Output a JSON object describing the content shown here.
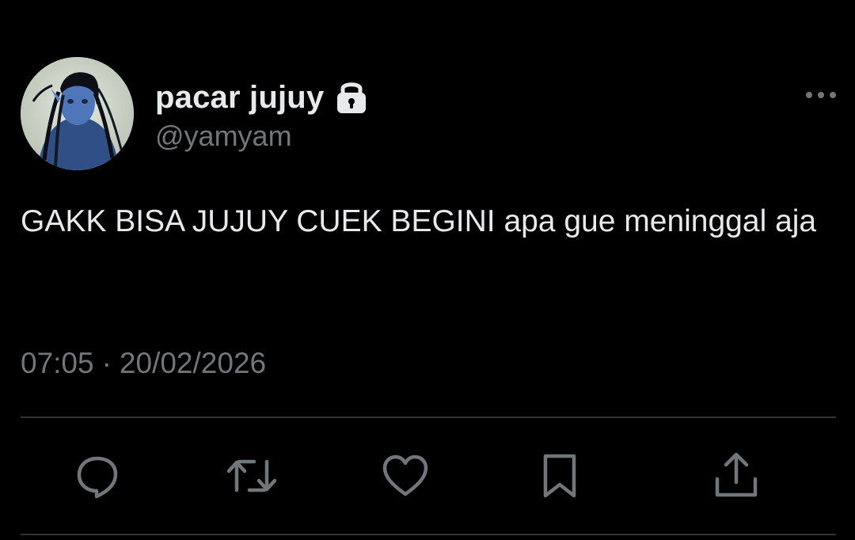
{
  "tweet": {
    "author": {
      "display_name": "pacar jujuy",
      "handle": "@yamyam",
      "protected_icon": "lock-icon",
      "avatar": "avatar"
    },
    "more_icon": "more-horizontal-icon",
    "text": "GAKK BISA JUJUY CUEK BEGINI apa gue meninggal aja",
    "time": "07:05",
    "separator": "·",
    "date": "20/02/2026",
    "actions": [
      {
        "name": "reply",
        "icon": "reply-icon"
      },
      {
        "name": "retweet",
        "icon": "retweet-icon"
      },
      {
        "name": "like",
        "icon": "heart-icon"
      },
      {
        "name": "bookmark",
        "icon": "bookmark-icon"
      },
      {
        "name": "share",
        "icon": "share-icon"
      }
    ]
  },
  "colors": {
    "background": "#000000",
    "text_primary": "#e7e9ea",
    "text_secondary": "#71767b",
    "divider": "#2f3336"
  }
}
